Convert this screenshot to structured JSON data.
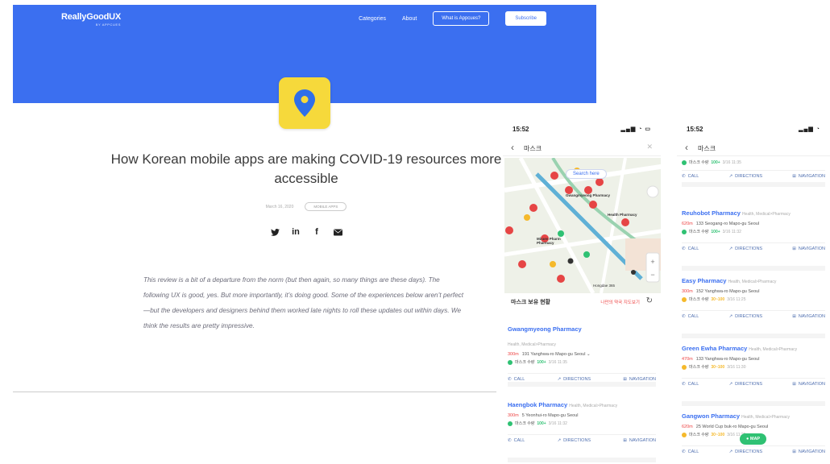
{
  "site": {
    "logo": "ReallyGoodUX",
    "logo_sub": "BY APPCUES",
    "nav": {
      "categories": "Categories",
      "about": "About",
      "what_is": "What is Appcues?",
      "subscribe": "Subscribe"
    },
    "accent": "#3b6ff0"
  },
  "article": {
    "title": "How Korean mobile apps are making COVID-19 resources more accessible",
    "date": "March 16, 2020",
    "tag": "MOBILE APPS",
    "body": "This review is a bit of a departure from the norm (but then again, so many things are these days). The following UX is good, yes. But more importantly, it’s doing good. Some of the experiences below aren’t perfect—but the developers and designers behind them worked late nights to roll these updates out within days. We think the results are pretty impressive.",
    "share_icons": [
      "twitter-icon",
      "linkedin-icon",
      "facebook-icon",
      "email-icon"
    ]
  },
  "phone1": {
    "time": "15:52",
    "title": "마스크",
    "map_search": "Search here",
    "map_labels": {
      "p1": "Gwangmyeong Pharmacy",
      "p2": "Health Pharmacy",
      "p3": "Miraen Pharm Pharmacy",
      "road": "Hongdae 365"
    },
    "sheet_title": "마스크 보유 현황",
    "sheet_right": "나만의 약국 지도보기",
    "cards": [
      {
        "name": "Gwangmyeong Pharmacy",
        "category": "Health, Medical>Pharmacy",
        "distance": "300m",
        "address": "191 Yanghwa-ro Mapo-gu Seoul",
        "stock_label": "마스크 수량",
        "stock_level": "100+",
        "stock_time": "3/16 11:35",
        "stock_color": "#2fc173"
      },
      {
        "name": "Haengbok Pharmacy",
        "category": "Health, Medical>Pharmacy",
        "distance": "300m",
        "address": "5 Yeonhui-ro Mapo-gu Seoul",
        "stock_label": "마스크 수량",
        "stock_level": "100+",
        "stock_time": "3/16 11:32",
        "stock_color": "#2fc173"
      }
    ],
    "actions": {
      "call": "CALL",
      "directions": "DIRECTIONS",
      "navigation": "NAVIGATION"
    }
  },
  "phone2": {
    "time": "15:52",
    "title": "마스크",
    "top_stock": {
      "label": "마스크 수량",
      "level": "100+",
      "time": "3/16 11:35",
      "color": "#2fc173"
    },
    "cards": [
      {
        "name": "Reuhobot Pharmacy",
        "category": "Health, Medical>Pharmacy",
        "distance": "620m",
        "address": "133 Seogang-ro Mapo-gu Seoul",
        "stock_label": "마스크 수량",
        "stock_level": "100+",
        "stock_time": "3/16 11:32",
        "stock_color": "#2fc173"
      },
      {
        "name": "Easy Pharmacy",
        "category": "Health, Medical>Pharmacy",
        "distance": "300m",
        "address": "152 Yanghwa-ro Mapo-gu Seoul",
        "stock_label": "마스크 수량",
        "stock_level": "30~100",
        "stock_time": "3/16 11:25",
        "stock_color": "#f5b92b"
      },
      {
        "name": "Green Ewha Pharmacy",
        "category": "Health, Medical>Pharmacy",
        "distance": "470m",
        "address": "133 Yanghwa-ro Mapo-gu Seoul",
        "stock_label": "마스크 수량",
        "stock_level": "30~100",
        "stock_time": "3/16 11:30",
        "stock_color": "#f5b92b"
      },
      {
        "name": "Gangwon Pharmacy",
        "category": "Health, Medical>Pharmacy",
        "distance": "620m",
        "address": "25 World Cup buk-ro Mapo-gu Seoul",
        "stock_label": "마스크 수량",
        "stock_level": "30~100",
        "stock_time": "3/16 11:25",
        "stock_color": "#f5b92b"
      }
    ],
    "actions": {
      "call": "CALL",
      "directions": "DIRECTIONS",
      "navigation": "NAVIGATION"
    },
    "map_button": "MAP"
  }
}
